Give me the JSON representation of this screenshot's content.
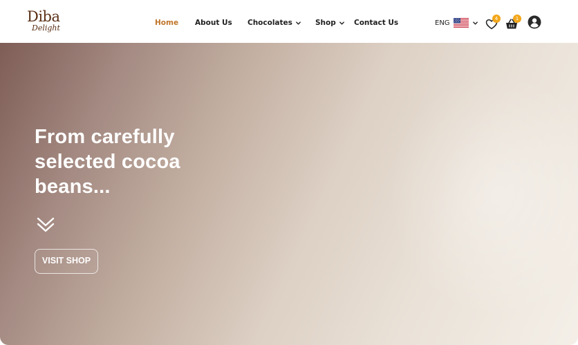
{
  "brand": {
    "logo_main": "Diba",
    "logo_sub": "Delight",
    "color": "#5a2f15"
  },
  "nav": {
    "items": [
      {
        "label": "Home",
        "active": true,
        "has_dropdown": false
      },
      {
        "label": "About Us",
        "active": false,
        "has_dropdown": false
      },
      {
        "label": "Chocolates",
        "active": false,
        "has_dropdown": true
      },
      {
        "label": "Shop",
        "active": false,
        "has_dropdown": true
      },
      {
        "label": "Contact Us",
        "active": false,
        "has_dropdown": false
      }
    ],
    "active_color": "#c0762a"
  },
  "header_actions": {
    "language": {
      "label": "ENG",
      "flag": "us-flag-icon"
    },
    "wishlist": {
      "icon": "heart-icon",
      "count": "4"
    },
    "cart": {
      "icon": "basket-icon",
      "count": "1"
    },
    "account": {
      "icon": "user-icon"
    },
    "badge_color": "#f2a71b"
  },
  "hero": {
    "title": "From carefully selected cocoa beans...",
    "scroll_icon": "double-chevron-down-icon",
    "cta_label": "VISIT SHOP"
  }
}
